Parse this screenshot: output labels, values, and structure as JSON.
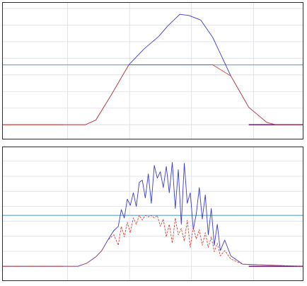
{
  "colors": {
    "background": "#ffffff",
    "grid": "#d9dde3",
    "threshold": "#6aaedc",
    "series_blue": "#3a3acb",
    "series_red": "#d2453a",
    "baseline_orange": "#e8933a",
    "baseline_purple": "#7a2a8a"
  },
  "chart_data": [
    {
      "type": "line",
      "grid": true,
      "x_range": [
        0,
        100
      ],
      "y_range": [
        0,
        100
      ],
      "threshold": 51.5,
      "series": [
        {
          "color": "#3a3acb",
          "x": [
            0,
            20,
            27.5,
            31,
            36,
            42,
            47,
            52,
            55,
            59,
            62,
            66,
            70,
            76,
            82,
            88,
            91,
            100
          ],
          "y": [
            0,
            0,
            0,
            4,
            25,
            51.5,
            65,
            76,
            85,
            95,
            94,
            90,
            75,
            42,
            15,
            2,
            0,
            0
          ]
        },
        {
          "color": "#d2453a",
          "x": [
            0,
            20,
            27.5,
            31,
            36,
            42,
            50,
            60,
            70,
            76,
            82,
            88,
            91,
            100
          ],
          "y": [
            0,
            0,
            0,
            4,
            25,
            51.5,
            51.5,
            51.5,
            51.5,
            42,
            15,
            2,
            0,
            0
          ]
        }
      ]
    },
    {
      "type": "line",
      "grid": true,
      "x_range": [
        0,
        100
      ],
      "y_range": [
        0,
        100
      ],
      "threshold": 48.5,
      "series": [
        {
          "color": "#3a3acb",
          "x": [
            0,
            25,
            28,
            31,
            33,
            35,
            37,
            38.5,
            39.5,
            40.5,
            41.5,
            42.5,
            43.5,
            44.5,
            45.5,
            46.5,
            47.5,
            48.5,
            49.5,
            50.5,
            51.5,
            52.5,
            53.5,
            54.5,
            55.5,
            56.5,
            57.5,
            58.5,
            59.5,
            60.5,
            61.5,
            62.5,
            63.5,
            64.5,
            65.5,
            66.5,
            67.5,
            68.5,
            69.5,
            70.5,
            71.5,
            72.5,
            74,
            76,
            80,
            100
          ],
          "y": [
            0,
            0,
            3,
            9,
            15,
            25,
            34,
            38,
            54,
            46,
            64,
            58,
            70,
            57,
            80,
            82,
            65,
            88,
            60,
            96,
            84,
            90,
            75,
            95,
            70,
            99,
            55,
            92,
            40,
            98,
            60,
            70,
            35,
            50,
            75,
            45,
            68,
            30,
            55,
            20,
            40,
            15,
            25,
            10,
            2,
            0
          ]
        },
        {
          "color": "#d2453a",
          "x": [
            0,
            25,
            28,
            31,
            33,
            35,
            37,
            38.5,
            39.5,
            40.5,
            41.5,
            42.5,
            43.5,
            44.5,
            45.5,
            46.5,
            47.5,
            48.5,
            49.5,
            50.5,
            51.5,
            52.5,
            53.5,
            54.5,
            55.5,
            56.5,
            57.5,
            58.5,
            59.5,
            60.5,
            61.5,
            62.5,
            63.5,
            64.5,
            65.5,
            66.5,
            67.5,
            68.5,
            69.5,
            70.5,
            71.5,
            72.5,
            74,
            76,
            80,
            100
          ],
          "y": [
            0,
            0,
            3,
            9,
            15,
            25,
            30,
            20,
            38,
            28,
            42,
            32,
            46,
            40,
            48.5,
            44,
            48.5,
            47,
            48.5,
            46,
            48.5,
            38,
            45,
            28,
            40,
            22,
            46,
            30,
            36,
            24,
            44,
            18,
            38,
            26,
            35,
            20,
            32,
            18,
            28,
            14,
            22,
            10,
            15,
            7,
            2,
            0
          ]
        }
      ]
    }
  ]
}
